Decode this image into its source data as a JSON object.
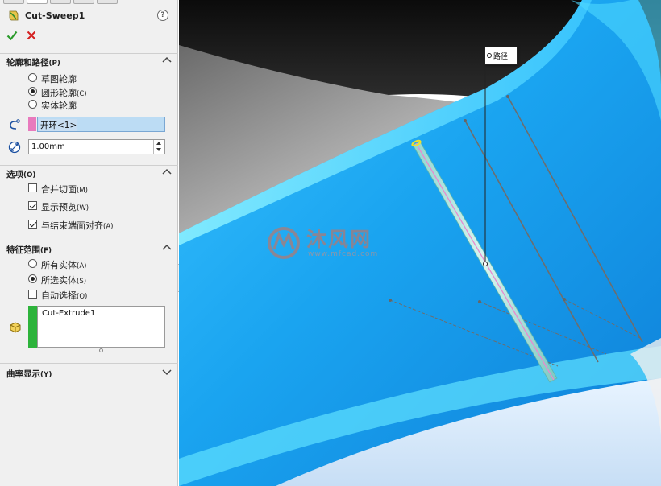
{
  "feature": {
    "title": "Cut-Sweep1",
    "help_icon": "question-mark-icon",
    "ok_icon": "green-check-icon",
    "cancel_icon": "red-x-icon"
  },
  "sections": {
    "profile_path": {
      "title": "轮廓和路径",
      "hotkey": "(P)",
      "options": [
        {
          "label": "草图轮廓",
          "hotkey": "",
          "selected": false
        },
        {
          "label": "圆形轮廓",
          "hotkey": "(C)",
          "selected": true
        },
        {
          "label": "实体轮廓",
          "hotkey": "",
          "selected": false
        }
      ],
      "path_value": "开环<1>",
      "path_swatch_color": "#e87abd",
      "diameter_value": "1.00mm"
    },
    "options": {
      "title": "选项",
      "hotkey": "(O)",
      "checks": [
        {
          "label": "合并切面",
          "hotkey": "(M)",
          "checked": false
        },
        {
          "label": "显示预览",
          "hotkey": "(W)",
          "checked": true
        },
        {
          "label": "与结束端面对齐",
          "hotkey": "(A)",
          "checked": true
        }
      ]
    },
    "feature_scope": {
      "title": "特征范围",
      "hotkey": "(F)",
      "radios": [
        {
          "label": "所有实体",
          "hotkey": "(A)",
          "selected": false
        },
        {
          "label": "所选实体",
          "hotkey": "(S)",
          "selected": true
        }
      ],
      "auto_select": {
        "label": "自动选择",
        "hotkey": "(O)",
        "checked": false
      },
      "bodies": [
        "Cut-Extrude1"
      ],
      "bodies_swatch_color": "#2db33b"
    },
    "curvature": {
      "title": "曲率显示",
      "hotkey": "(Y)"
    }
  },
  "viewport": {
    "path_callout": "路径",
    "watermark_text": "沐风网",
    "watermark_url": "www.mfcad.com",
    "part_color": "#1ea7f0"
  }
}
